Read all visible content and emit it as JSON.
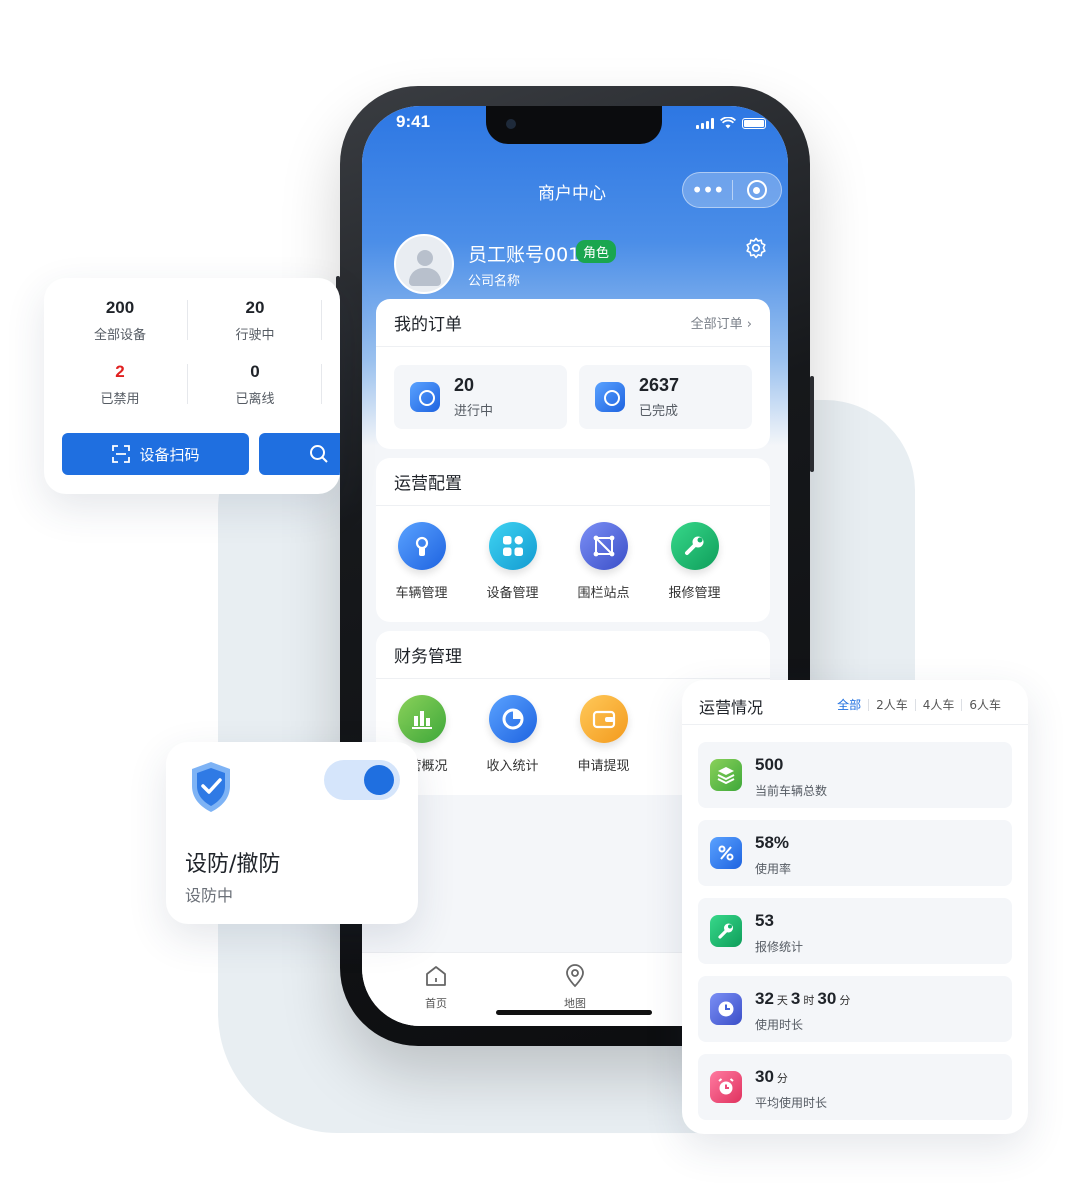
{
  "phone": {
    "status_time": "9:41",
    "nav_title": "商户中心",
    "user": {
      "name": "员工账号001",
      "role": "角色",
      "company": "公司名称"
    },
    "orders": {
      "title": "我的订单",
      "link": "全部订单",
      "items": [
        {
          "value": "20",
          "label": "进行中",
          "color": "#2f7ae5"
        },
        {
          "value": "2637",
          "label": "已完成",
          "color": "#2f7ae5"
        }
      ]
    },
    "operations": {
      "title": "运营配置",
      "items": [
        {
          "label": "车辆管理",
          "icon": "scooter-icon",
          "color": "#2f7ae5"
        },
        {
          "label": "设备管理",
          "icon": "device-grid-icon",
          "color": "#1bb3d9"
        },
        {
          "label": "围栏站点",
          "icon": "fence-icon",
          "color": "#4564d8"
        },
        {
          "label": "报修管理",
          "icon": "wrench-icon",
          "color": "#14b36b"
        }
      ]
    },
    "finance": {
      "title": "财务管理",
      "items": [
        {
          "label": "经营概况",
          "icon": "bar-chart-icon",
          "color": "#4cb84a"
        },
        {
          "label": "收入统计",
          "icon": "pie-icon",
          "color": "#2f7ae5"
        },
        {
          "label": "申请提现",
          "icon": "wallet-icon",
          "color": "#f5a623"
        }
      ]
    },
    "tabbar": [
      {
        "label": "首页",
        "icon": "home-icon"
      },
      {
        "label": "地图",
        "icon": "map-pin-icon"
      }
    ]
  },
  "stats_card": {
    "items": [
      {
        "value": "200",
        "label": "全部设备",
        "color": "#1f2329"
      },
      {
        "value": "20",
        "label": "行驶中",
        "color": "#1f2329"
      },
      {
        "value": "2",
        "label": "已禁用",
        "color": "#e02020"
      },
      {
        "value": "0",
        "label": "已离线",
        "color": "#1f2329"
      }
    ],
    "scan_button": "设备扫码"
  },
  "arm_card": {
    "title": "设防/撤防",
    "status": "设防中",
    "toggle_on": true
  },
  "ops_card": {
    "title": "运营情况",
    "tabs": [
      "全部",
      "2人车",
      "4人车",
      "6人车"
    ],
    "active_tab": "全部",
    "items": [
      {
        "label": "当前车辆总数",
        "value": "500",
        "icon": "layers-icon",
        "color": "#4cb84a"
      },
      {
        "label": "使用率",
        "value": "58%",
        "icon": "percent-icon",
        "color": "#2f7ae5"
      },
      {
        "label": "报修统计",
        "value": "53",
        "icon": "wrench-icon",
        "color": "#14b36b"
      },
      {
        "label": "使用时长",
        "parts": [
          "32",
          "天",
          "3",
          "时",
          "30",
          "分"
        ],
        "icon": "clock-icon",
        "color": "#4564d8"
      },
      {
        "label": "平均使用时长",
        "parts": [
          "30",
          "分"
        ],
        "icon": "alarm-clock-icon",
        "color": "#ec4a78"
      }
    ]
  }
}
